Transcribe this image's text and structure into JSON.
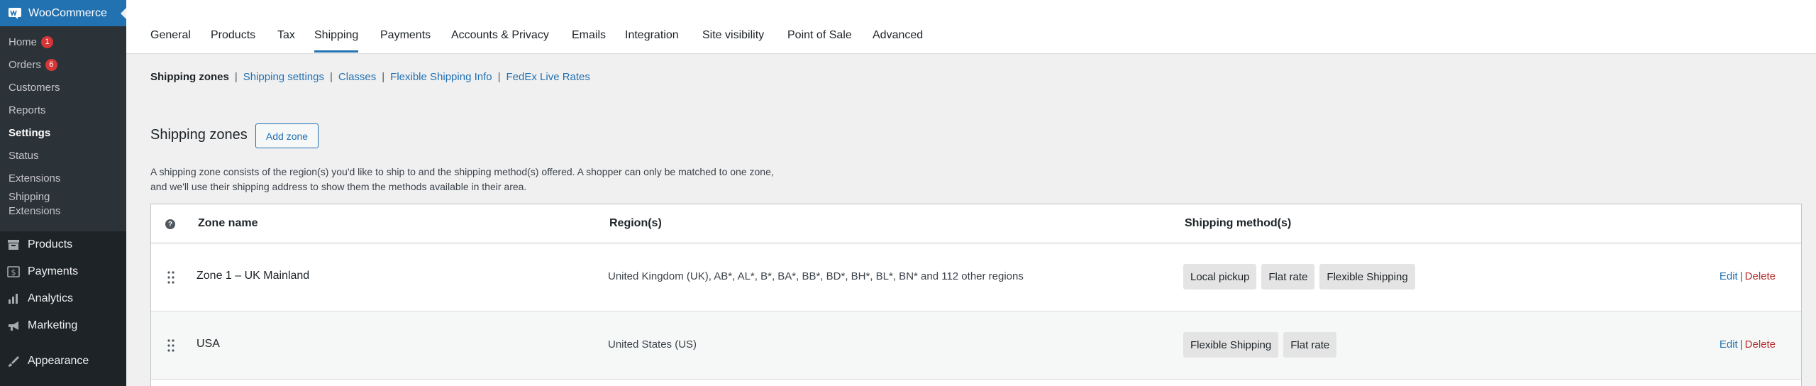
{
  "sidebar": {
    "brand": "WooCommerce",
    "submenu": [
      {
        "label": "Home",
        "badge": "1"
      },
      {
        "label": "Orders",
        "badge": "6"
      },
      {
        "label": "Customers"
      },
      {
        "label": "Reports"
      },
      {
        "label": "Settings",
        "current": true
      },
      {
        "label": "Status"
      },
      {
        "label": "Extensions"
      },
      {
        "label": "Shipping Extensions"
      }
    ],
    "menu": [
      {
        "label": "Products",
        "icon": "archive-icon"
      },
      {
        "label": "Payments",
        "icon": "dollar-icon"
      },
      {
        "label": "Analytics",
        "icon": "bar-chart-icon"
      },
      {
        "label": "Marketing",
        "icon": "megaphone-icon"
      },
      {
        "label": "Appearance",
        "icon": "paintbrush-icon"
      }
    ]
  },
  "tabs": [
    "General",
    "Products",
    "Tax",
    "Shipping",
    "Payments",
    "Accounts & Privacy",
    "Emails",
    "Integration",
    "Site visibility",
    "Point of Sale",
    "Advanced"
  ],
  "active_tab": "Shipping",
  "subnav": {
    "current": "Shipping zones",
    "links": [
      "Shipping settings",
      "Classes",
      "Flexible Shipping Info",
      "FedEx Live Rates"
    ]
  },
  "section": {
    "title": "Shipping zones",
    "add_button": "Add zone",
    "description": "A shipping zone consists of the region(s) you'd like to ship to and the shipping method(s) offered. A shopper can only be matched to one zone, and we'll use their shipping address to show them the methods available in their area."
  },
  "table": {
    "help": "?",
    "headers": {
      "zone": "Zone name",
      "regions": "Region(s)",
      "methods": "Shipping method(s)"
    },
    "rows": [
      {
        "zone": "Zone 1 – UK Mainland",
        "regions": "United Kingdom (UK), AB*, AL*, B*, BA*, BB*, BD*, BH*, BL*, BN* and 112 other regions",
        "methods": [
          "Local pickup",
          "Flat rate",
          "Flexible Shipping"
        ],
        "edit": "Edit",
        "separator": "|",
        "delete": "Delete"
      },
      {
        "zone": "USA",
        "regions": "United States (US)",
        "methods": [
          "Flexible Shipping",
          "Flat rate"
        ],
        "edit": "Edit",
        "separator": "|",
        "delete": "Delete"
      }
    ]
  },
  "colors": {
    "accent": "#2271b1",
    "sidebar": "#1d2327",
    "submenu": "#2c3338",
    "badge": "#d63638",
    "delete": "#b32d2e"
  }
}
